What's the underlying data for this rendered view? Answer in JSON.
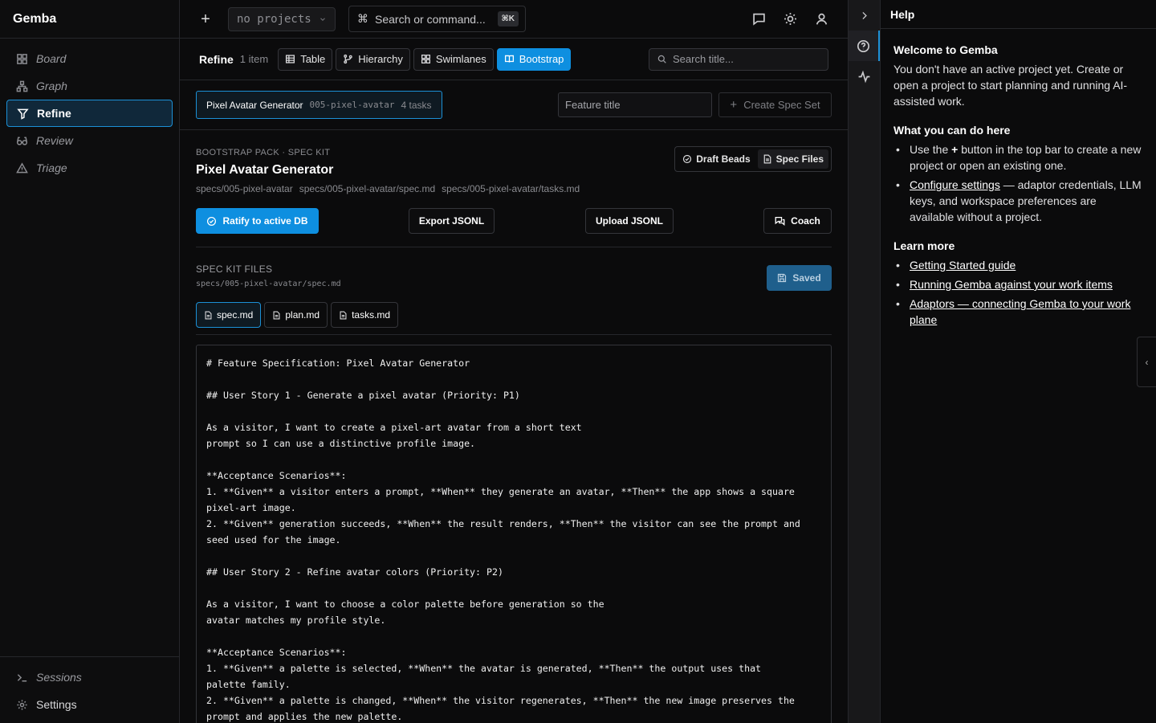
{
  "app": {
    "name": "Gemba"
  },
  "sidebar": {
    "items": [
      {
        "label": "Board",
        "icon": "grid-icon"
      },
      {
        "label": "Graph",
        "icon": "graph-icon"
      },
      {
        "label": "Refine",
        "icon": "filter-icon",
        "active": true
      },
      {
        "label": "Review",
        "icon": "glasses-icon"
      },
      {
        "label": "Triage",
        "icon": "triangle-alert-icon"
      }
    ],
    "bottom": [
      {
        "label": "Sessions",
        "icon": "terminal-icon"
      },
      {
        "label": "Settings",
        "icon": "gear-icon"
      }
    ]
  },
  "topbar": {
    "project_select": "no projects",
    "command_placeholder": "Search or command...",
    "command_shortcut": "⌘K"
  },
  "viewbar": {
    "title": "Refine",
    "count": "1 item",
    "views": [
      "Table",
      "Hierarchy",
      "Swimlanes",
      "Bootstrap"
    ],
    "active_view": "Bootstrap",
    "search_placeholder": "Search title..."
  },
  "specbar": {
    "chip_name": "Pixel Avatar Generator",
    "chip_slug": "005-pixel-avatar",
    "chip_tasks": "4 tasks",
    "feature_placeholder": "Feature title",
    "create_label": "Create Spec Set"
  },
  "spec": {
    "overline": "BOOTSTRAP PACK · SPEC KIT",
    "title": "Pixel Avatar Generator",
    "paths": [
      "specs/005-pixel-avatar",
      "specs/005-pixel-avatar/spec.md",
      "specs/005-pixel-avatar/tasks.md"
    ],
    "toggle": {
      "draft": "Draft Beads",
      "files": "Spec Files"
    },
    "actions": {
      "ratify": "Ratify to active DB",
      "export": "Export JSONL",
      "upload": "Upload JSONL",
      "coach": "Coach"
    }
  },
  "files": {
    "overline": "SPEC KIT FILES",
    "path": "specs/005-pixel-avatar/spec.md",
    "saved_label": "Saved",
    "tabs": [
      "spec.md",
      "plan.md",
      "tasks.md"
    ],
    "active_tab": "spec.md",
    "content": "# Feature Specification: Pixel Avatar Generator\n\n## User Story 1 - Generate a pixel avatar (Priority: P1)\n\nAs a visitor, I want to create a pixel-art avatar from a short text\nprompt so I can use a distinctive profile image.\n\n**Acceptance Scenarios**:\n1. **Given** a visitor enters a prompt, **When** they generate an avatar, **Then** the app shows a square\npixel-art image.\n2. **Given** generation succeeds, **When** the result renders, **Then** the visitor can see the prompt and\nseed used for the image.\n\n## User Story 2 - Refine avatar colors (Priority: P2)\n\nAs a visitor, I want to choose a color palette before generation so the\navatar matches my profile style.\n\n**Acceptance Scenarios**:\n1. **Given** a palette is selected, **When** the avatar is generated, **Then** the output uses that\npalette family.\n2. **Given** a palette is changed, **When** the visitor regenerates, **Then** the new image preserves the\nprompt and applies the new palette."
  },
  "help": {
    "title": "Help",
    "welcome_heading": "Welcome to Gemba",
    "welcome_text": "You don't have an active project yet. Create or open a project to start planning and running AI-assisted work.",
    "can_do_heading": "What you can do here",
    "bullet1_pre": "Use the ",
    "bullet1_bold": "+",
    "bullet1_post": " button in the top bar to create a new project or open an existing one.",
    "bullet2_link": "Configure settings",
    "bullet2_post": " — adaptor credentials, LLM keys, and workspace preferences are available without a project.",
    "learn_heading": "Learn more",
    "links": [
      "Getting Started guide",
      "Running Gemba against your work items",
      "Adaptors — connecting Gemba to your work plane"
    ]
  }
}
